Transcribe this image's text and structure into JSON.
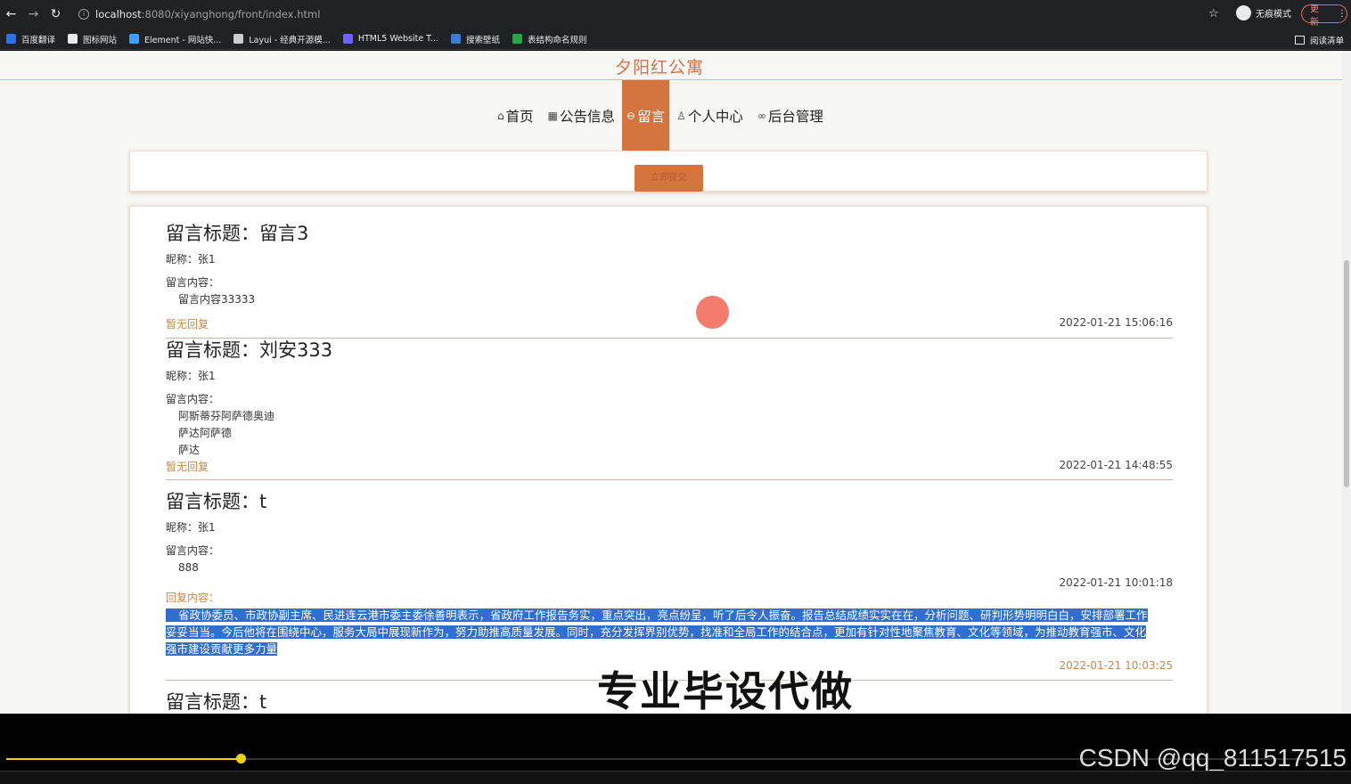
{
  "browser": {
    "url_host": "localhost",
    "url_path": ":8080/xiyanghong/front/index.html",
    "incognito_label": "无痕模式",
    "update_label": "更新",
    "bookmarks": [
      {
        "label": "百度翻译",
        "color": "#2a72e5"
      },
      {
        "label": "图标网站",
        "color": "#e8eaed"
      },
      {
        "label": "Element - 网站快...",
        "color": "#409eff"
      },
      {
        "label": "Layui - 经典开源模...",
        "color": "#cccccc"
      },
      {
        "label": "HTML5 Website T...",
        "color": "#6c63ff"
      },
      {
        "label": "搜索壁纸",
        "color": "#3a7bd5"
      },
      {
        "label": "表结构命名规则",
        "color": "#28a745"
      }
    ],
    "reading_list_label": "阅读清单"
  },
  "site": {
    "title": "夕阳红公寓",
    "accent_color": "#d4743f",
    "nav": [
      {
        "label": "首页",
        "icon": "home-icon",
        "glyph": "⌂",
        "active": false
      },
      {
        "label": "公告信息",
        "icon": "grid-icon",
        "glyph": "▦",
        "active": false
      },
      {
        "label": "留言",
        "icon": "message-icon",
        "glyph": "⊖",
        "active": true
      },
      {
        "label": "个人中心",
        "icon": "user-icon",
        "glyph": "♙",
        "active": false
      },
      {
        "label": "后台管理",
        "icon": "link-icon",
        "glyph": "∞",
        "active": false
      }
    ],
    "submit_label": "立即提交"
  },
  "messages": [
    {
      "title": "留言标题：留言3",
      "nickname": "昵称：张1",
      "content_label": "留言内容：",
      "content_lines": [
        "留言内容33333"
      ],
      "reply_status": "暂无回复",
      "time": "2022-01-21 15:06:16"
    },
    {
      "title": "留言标题：刘安333",
      "nickname": "昵称：张1",
      "content_label": "留言内容：",
      "content_lines": [
        "阿斯蒂芬阿萨德奥迪",
        "萨达阿萨德",
        "萨达"
      ],
      "reply_status": "暂无回复",
      "time": "2022-01-21 14:48:55"
    },
    {
      "title": "留言标题：t",
      "nickname": "昵称：张1",
      "content_label": "留言内容：",
      "content_lines": [
        "888"
      ],
      "time": "2022-01-21 10:01:18",
      "reply_label": "回复内容：",
      "reply_lines": [
        "省政协委员、市政协副主席、民进连云港市委主委徐善明表示，省政府工作报告务实，重点突出，亮点纷呈，听了后令人振奋。报告总结成绩实实在在，分析问题、研判形势明明白白，安排部署工作",
        "妥妥当当。今后他将在围绕中心，服务大局中展现新作为，努力助推高质量发展。同时，充分发挥界别优势，找准和全局工作的结合点，更加有针对性地聚焦教育、文化等领域，为推动教育强市、文化",
        "强市建设贡献更多力量"
      ],
      "reply_time": "2022-01-21 10:03:25"
    },
    {
      "title": "留言标题：t"
    }
  ],
  "overlay": {
    "watermark": "专业毕设代做",
    "csdn": "CSDN @qq_811517515",
    "video_progress_fraction": 0.18
  }
}
